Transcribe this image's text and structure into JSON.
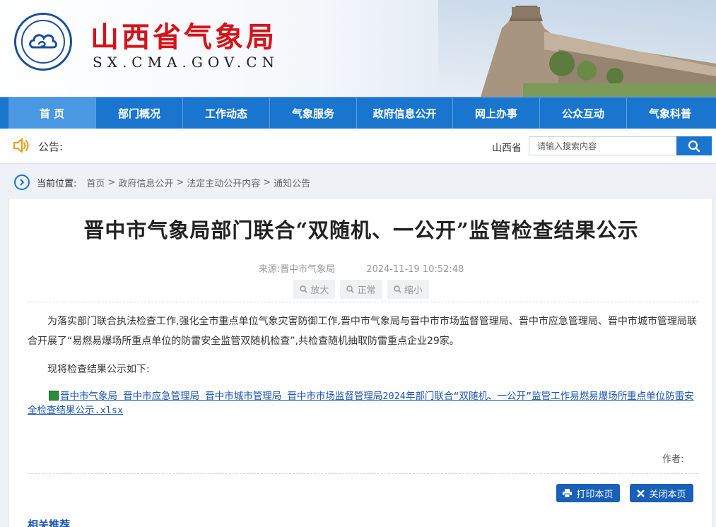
{
  "header": {
    "site_title": "山西省气象局",
    "site_domain": "SX.CMA.GOV.CN",
    "logo_icon": "cma-logo-icon"
  },
  "nav": {
    "items": [
      {
        "label": "首 页",
        "active": true
      },
      {
        "label": "部门概况"
      },
      {
        "label": "工作动态"
      },
      {
        "label": "气象服务"
      },
      {
        "label": "政府信息公开"
      },
      {
        "label": "网上办事"
      },
      {
        "label": "公众互动"
      },
      {
        "label": "气象科普"
      }
    ]
  },
  "notice": {
    "label": "公告:",
    "scroll_text": "山西省",
    "icon": "speaker-icon"
  },
  "search": {
    "placeholder": "请输入搜索内容",
    "icon": "search-icon"
  },
  "breadcrumb": {
    "label": "当前位置:",
    "items": [
      "首页",
      "政府信息公开",
      "法定主动公开内容",
      "通知公告"
    ],
    "separator": ">"
  },
  "article": {
    "title": "晋中市气象局部门联合“双随机、一公开”监管检查结果公示",
    "source": "来源:晋中市气象局",
    "date": "2024-11-19 10:52:48",
    "font_tools": [
      "放大",
      "正常",
      "缩小"
    ],
    "paragraph1": "为落实部门联合执法检查工作,强化全市重点单位气象灾害防御工作,晋中市气象局与晋中市市场监督管理局、晋中市应急管理局、晋中市城市管理局联合开展了“易燃易爆场所重点单位的防雷安全监管双随机检查”,共检查随机抽取防雷重点企业29家。",
    "paragraph2": "现将检查结果公示如下:",
    "attachment": "晋中市气象局 晋中市应急管理局 晋中市城市管理局 晋中市市场监督管理局2024年部门联合“双随机、一公开”监管工作易燃易爆场所重点单位防雷安全检查结果公示.xlsx",
    "author_label": "作者:",
    "print_button": "打印本页",
    "close_button": "关闭本页",
    "related_label": "相关推荐"
  },
  "colors": {
    "brand_red": "#d4141b",
    "nav_blue": "#1a75cf",
    "nav_active": "#4a98e2",
    "button_blue": "#1a5fb8",
    "link_blue": "#1a55b0"
  }
}
